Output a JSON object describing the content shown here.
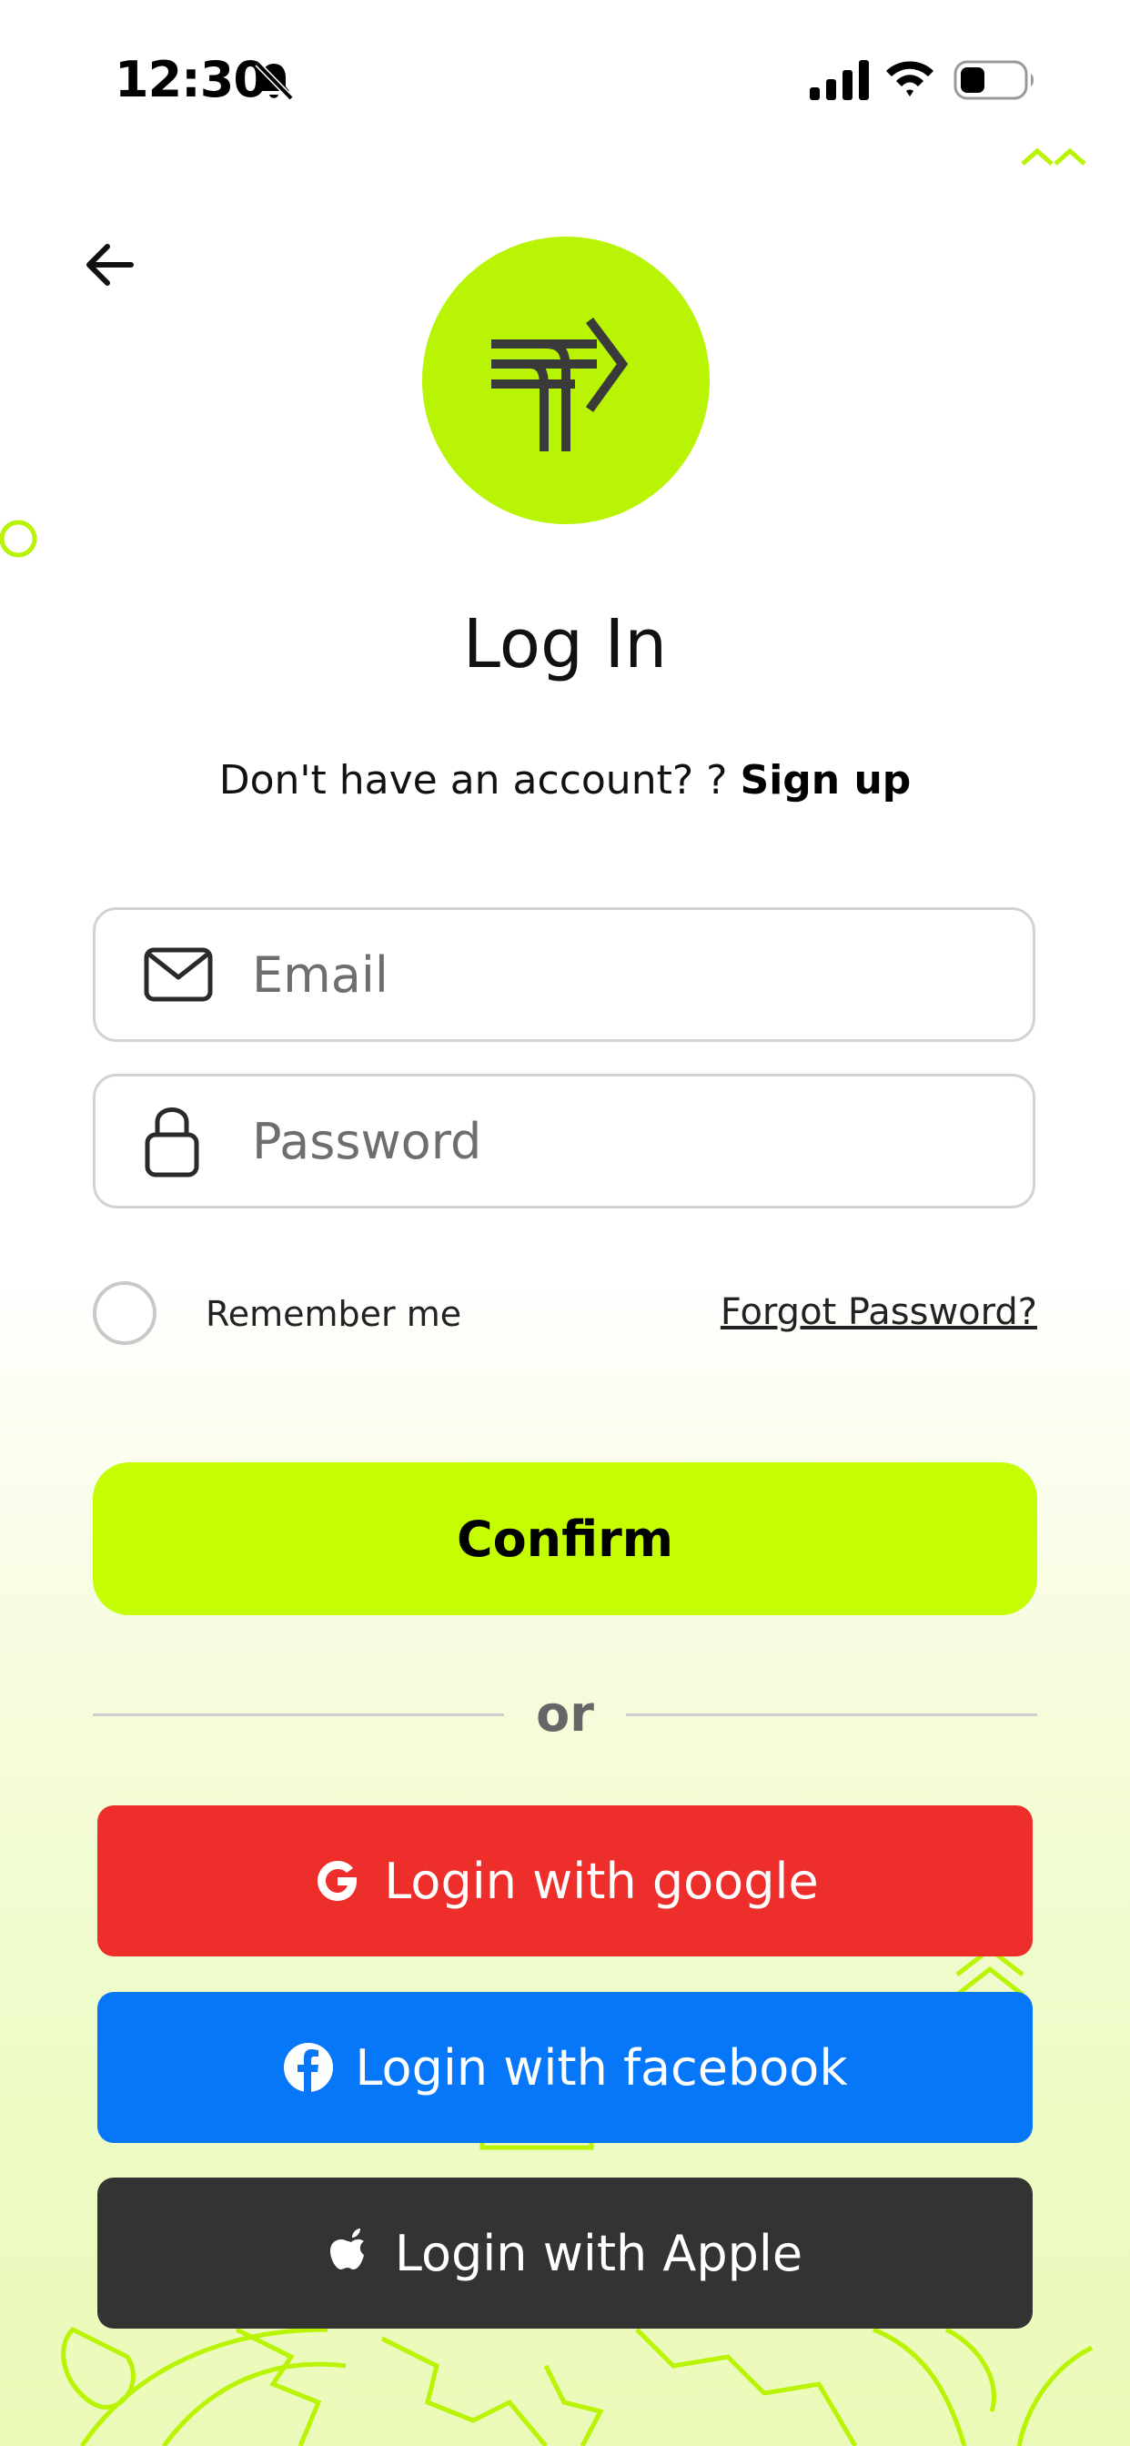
{
  "status_bar": {
    "time": "12:30"
  },
  "header": {
    "title": "Log In"
  },
  "signup_prompt": {
    "text": "Don't have an account? ?",
    "link": "Sign up"
  },
  "form": {
    "email_placeholder": "Email",
    "password_placeholder": "Password",
    "remember_label": "Remember me",
    "forgot_label": "Forgot Password?",
    "confirm_label": "Confirm"
  },
  "divider": {
    "label": "or"
  },
  "social": {
    "google_label": "Login with google",
    "facebook_label": "Login with facebook",
    "apple_label": "Login with Apple"
  },
  "colors": {
    "accent": "#c5fd02",
    "logo_bg": "#b8f403",
    "google": "#ee2e2b",
    "facebook": "#0677f8",
    "apple": "#333333"
  }
}
